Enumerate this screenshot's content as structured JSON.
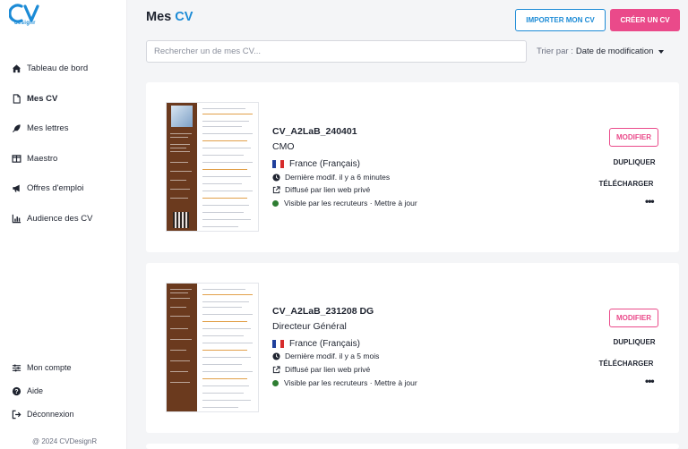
{
  "brand": {
    "logo_text": "CV",
    "logo_sub": "designr"
  },
  "sidebar": {
    "items": [
      {
        "label": "Tableau de bord"
      },
      {
        "label": "Mes CV"
      },
      {
        "label": "Mes lettres"
      },
      {
        "label": "Maestro"
      },
      {
        "label": "Offres d'emploi"
      },
      {
        "label": "Audience des CV"
      }
    ],
    "bottom_items": [
      {
        "label": "Mon compte"
      },
      {
        "label": "Aide"
      },
      {
        "label": "Déconnexion"
      }
    ],
    "copyright": "@ 2024 CVDesignR"
  },
  "header": {
    "title_prefix": "Mes",
    "title_accent": "CV",
    "import_label": "IMPORTER MON CV",
    "create_label": "CRÉER UN CV"
  },
  "search": {
    "placeholder": "Rechercher un de mes CV..."
  },
  "sort": {
    "label": "Trier par :",
    "value": "Date de modification"
  },
  "cvs": [
    {
      "name": "CV_A2LaB_240401",
      "role": "CMO",
      "language": "France (Français)",
      "modified": "Dernière modif. il y a 6 minutes",
      "shared": "Diffusé par lien web privé",
      "visibility": "Visible par les recruteurs · Mettre à jour",
      "modify_label": "MODIFIER",
      "duplicate_label": "DUPLIQUER",
      "download_label": "TÉLÉCHARGER",
      "more_label": "•••",
      "sidebar_color": "#6b3a1e"
    },
    {
      "name": "CV_A2LaB_231208 DG",
      "role": "Directeur Général",
      "language": "France (Français)",
      "modified": "Dernière modif. il y a 5 mois",
      "shared": "Diffusé par lien web privé",
      "visibility": "Visible par les recruteurs · Mettre à jour",
      "modify_label": "MODIFIER",
      "duplicate_label": "DUPLIQUER",
      "download_label": "TÉLÉCHARGER",
      "more_label": "•••",
      "sidebar_color": "#6b3a1e"
    }
  ],
  "colors": {
    "accent_blue": "#1c8bd6",
    "accent_pink": "#ea4a8a",
    "visible_green": "#2e7d32"
  }
}
